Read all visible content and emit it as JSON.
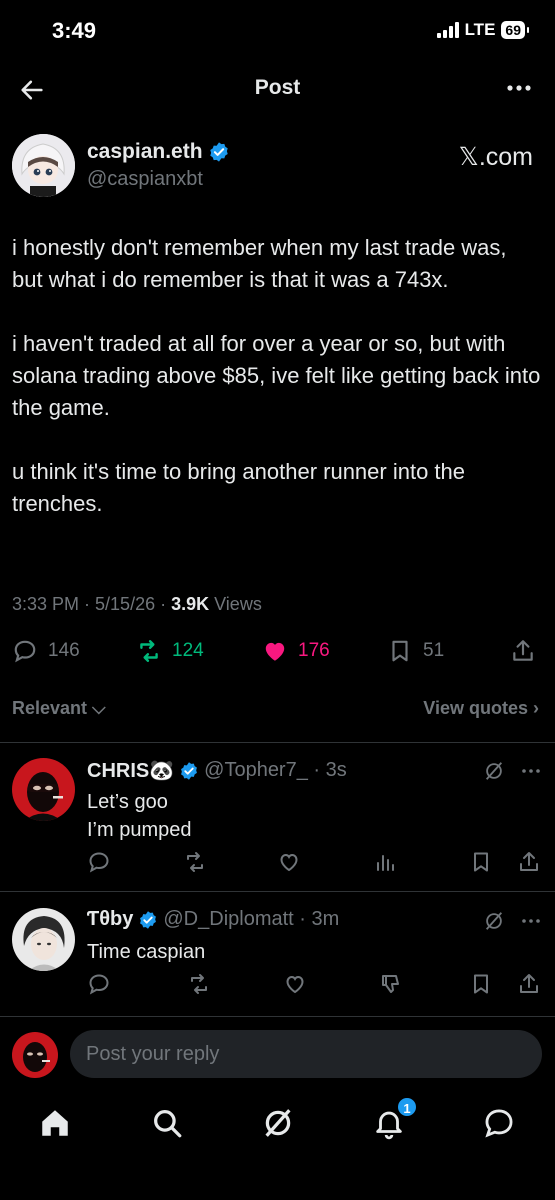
{
  "status_bar": {
    "time": "3:49",
    "network": "LTE",
    "battery": "69"
  },
  "nav": {
    "title": "Post"
  },
  "post": {
    "author_name": "caspian.eth",
    "author_handle": "@caspianxbt",
    "source_label": "𝕏.com",
    "paragraphs": [
      "i honestly don't remember when my last trade was, but what i do remember is that it was a 743x.",
      "i haven't traded at all for over a year or so, but with solana trading above $85, ive felt like getting back into the game.",
      "u think it's time to bring another runner into the trenches."
    ],
    "meta_time": "3:33 PM · 5/15/26 · ",
    "meta_views_count": "3.9K",
    "meta_views_label": " Views",
    "stats": {
      "replies": "146",
      "reposts": "124",
      "likes": "176",
      "bookmarks": "51"
    },
    "colors": {
      "repost": "#00ba7c",
      "like": "#f91880",
      "verified": "#1d9bf0"
    }
  },
  "filter": {
    "left": "Relevant ⌵",
    "right": "View quotes ›"
  },
  "replies": [
    {
      "name": "CHRIS🐼",
      "handle": "@Topher7_ · 3s",
      "lines": [
        "Let’s goo",
        "I’m pumped"
      ]
    },
    {
      "name": "Ƭθby",
      "handle": "@D_Diplomatt · 3m",
      "lines": [
        "Time caspian"
      ]
    }
  ],
  "composer": {
    "placeholder": "Post your reply"
  },
  "tabbar": {
    "notification_count": "1"
  }
}
